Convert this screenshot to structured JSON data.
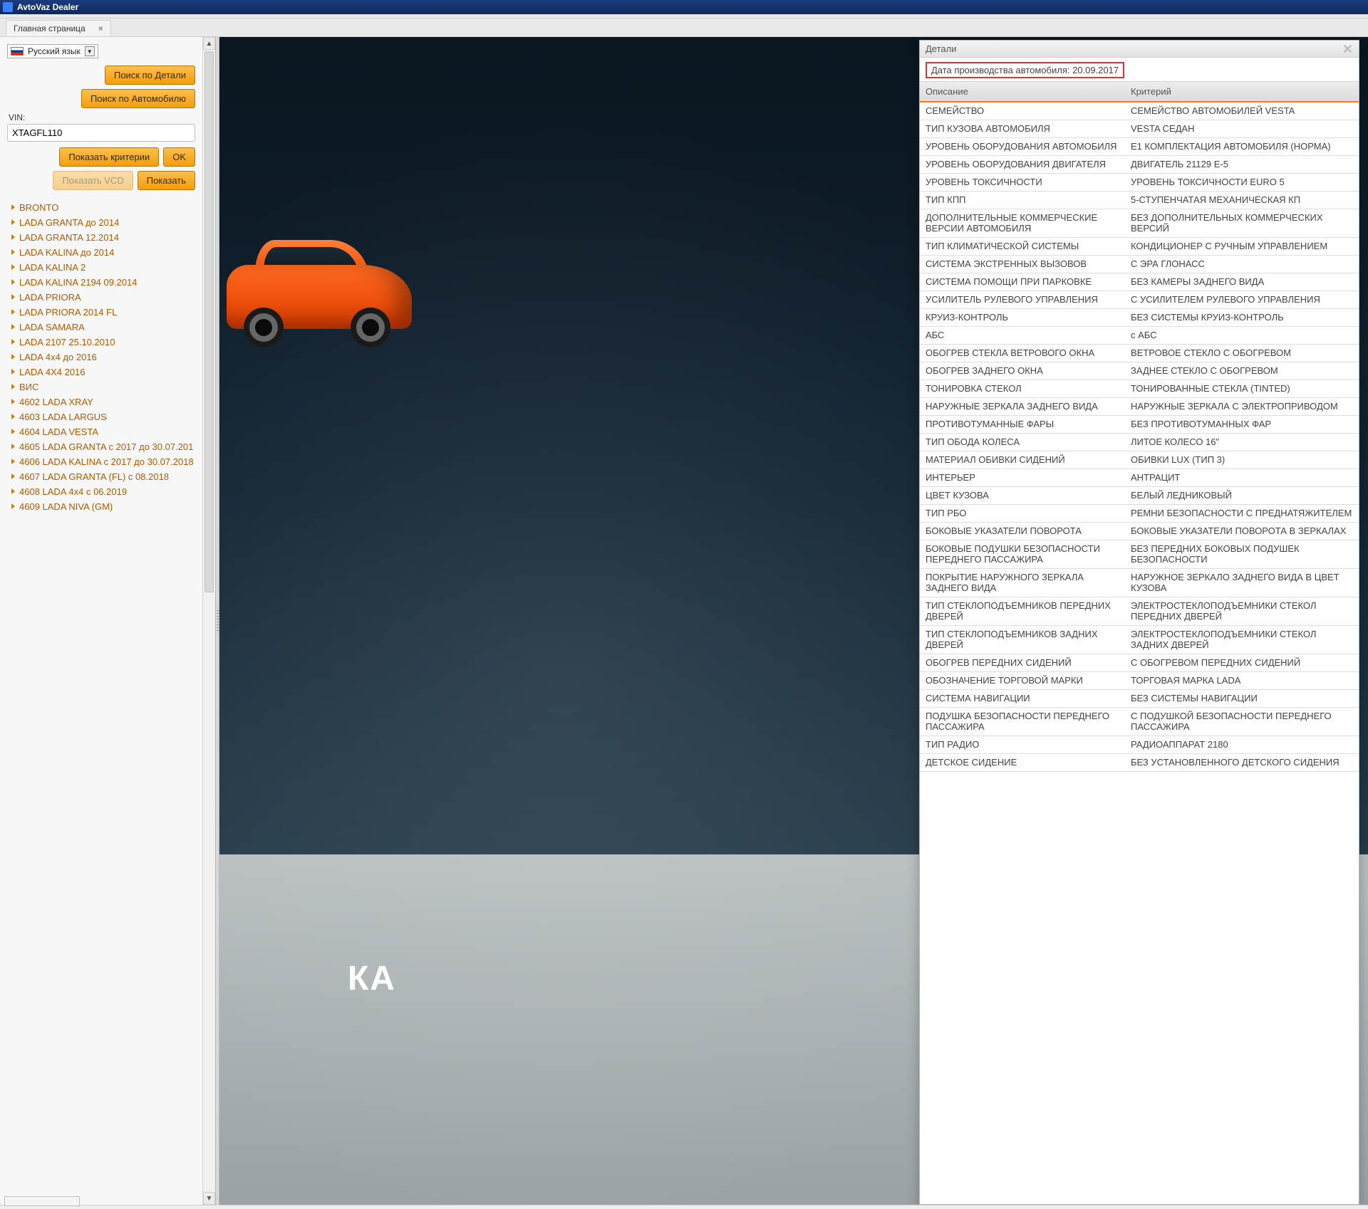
{
  "window": {
    "title": "AvtoVaz Dealer"
  },
  "tabs": [
    {
      "label": "Главная страница"
    }
  ],
  "sidebar": {
    "language": "Русский язык",
    "buttons": {
      "search_parts": "Поиск по Детали",
      "search_vehicle": "Поиск по Автомобилю",
      "show_criteria": "Показать критерии",
      "ok": "OK",
      "show_vcd": "Показать VCD",
      "show": "Показать"
    },
    "vin_label": "VIN:",
    "vin_value": "XTAGFL110",
    "tree": [
      "BRONTO",
      "LADA GRANTA до 2014",
      "LADA GRANTA 12.2014",
      "LADA KALINA до 2014",
      "LADA KALINA 2",
      "LADA KALINA 2194 09.2014",
      "LADA PRIORA",
      "LADA PRIORA 2014 FL",
      "LADA SAMARA",
      "LADA 2107 25.10.2010",
      "LADA 4x4 до 2016",
      "LADA 4X4 2016",
      "ВИС",
      "4602 LADA XRAY",
      "4603 LADA LARGUS",
      "4604 LADA VESTA",
      "4605 LADA GRANTA с 2017 до 30.07.201",
      "4606 LADA KALINA с 2017 до 30.07.2018",
      "4607 LADA GRANTA (FL) с 08.2018",
      "4608 LADA 4x4 с 06.2019",
      "4609 LADA NIVA (GM)"
    ]
  },
  "hero": {
    "text": "КА"
  },
  "modal": {
    "title": "Детали",
    "date": "Дата производства автомобиля: 20.09.2017",
    "col_desc": "Описание",
    "col_crit": "Критерий",
    "rows": [
      [
        "СЕМЕЙСТВО",
        "СЕМЕЙСТВО АВТОМОБИЛЕЙ VESTA"
      ],
      [
        "ТИП КУЗОВА АВТОМОБИЛЯ",
        "VESTA СЕДАН"
      ],
      [
        "УРОВЕНЬ ОБОРУДОВАНИЯ АВТОМОБИЛЯ",
        "Е1 КОМПЛЕКТАЦИЯ АВТОМОБИЛЯ (НОРМА)"
      ],
      [
        "УРОВЕНЬ ОБОРУДОВАНИЯ ДВИГАТЕЛЯ",
        "ДВИГАТЕЛЬ 21129 Е-5"
      ],
      [
        "УРОВЕНЬ ТОКСИЧНОСТИ",
        "УРОВЕНЬ ТОКСИЧНОСТИ EURO 5"
      ],
      [
        "ТИП КПП",
        "5-СТУПЕНЧАТАЯ МЕХАНИЧЕСКАЯ КП"
      ],
      [
        "ДОПОЛНИТЕЛЬНЫЕ КОММЕРЧЕСКИЕ ВЕРСИИ АВТОМОБИЛЯ",
        "БЕЗ ДОПОЛНИТЕЛЬНЫХ КОММЕРЧЕСКИХ ВЕРСИЙ"
      ],
      [
        "ТИП КЛИМАТИЧЕСКОЙ СИСТЕМЫ",
        "КОНДИЦИОНЕР С РУЧНЫМ УПРАВЛЕНИЕМ"
      ],
      [
        "СИСТЕМА ЭКСТРЕННЫХ ВЫЗОВОВ",
        "С ЭРА ГЛОНАСС"
      ],
      [
        "СИСТЕМА ПОМОЩИ ПРИ ПАРКОВКЕ",
        "БЕЗ КАМЕРЫ ЗАДНЕГО ВИДА"
      ],
      [
        "УСИЛИТЕЛЬ РУЛЕВОГО УПРАВЛЕНИЯ",
        "С УСИЛИТЕЛЕМ РУЛЕВОГО УПРАВЛЕНИЯ"
      ],
      [
        "КРУИЗ-КОНТРОЛЬ",
        "БЕЗ СИСТЕМЫ КРУИЗ-КОНТРОЛЬ"
      ],
      [
        "АБС",
        "с АБС"
      ],
      [
        "ОБОГРЕВ СТЕКЛА ВЕТРОВОГО ОКНА",
        "ВЕТРОВОЕ СТЕКЛО С ОБОГРЕВОМ"
      ],
      [
        "ОБОГРЕВ ЗАДНЕГО ОКНА",
        "ЗАДНЕЕ СТЕКЛО С ОБОГРЕВОМ"
      ],
      [
        "ТОНИРОВКА СТЕКОЛ",
        "ТОНИРОВАННЫЕ СТЕКЛА (TINTED)"
      ],
      [
        "НАРУЖНЫЕ ЗЕРКАЛА ЗАДНЕГО ВИДА",
        "НАРУЖНЫЕ ЗЕРКАЛА С ЭЛЕКТРОПРИВОДОМ"
      ],
      [
        "ПРОТИВОТУМАННЫЕ ФАРЫ",
        "БЕЗ ПРОТИВОТУМАННЫХ ФАР"
      ],
      [
        "ТИП ОБОДА КОЛЕСА",
        "ЛИТОЕ КОЛЕСО 16\""
      ],
      [
        "МАТЕРИАЛ ОБИВКИ СИДЕНИЙ",
        "ОБИВКИ LUX (ТИП 3)"
      ],
      [
        "ИНТЕРЬЕР",
        "АНТРАЦИТ"
      ],
      [
        "ЦВЕТ КУЗОВА",
        "БЕЛЫЙ ЛЕДНИКОВЫЙ"
      ],
      [
        "ТИП РБО",
        "РЕМНИ БЕЗОПАСНОСТИ С ПРЕДНАТЯЖИТЕЛЕМ"
      ],
      [
        "БОКОВЫЕ УКАЗАТЕЛИ ПОВОРОТА",
        "БОКОВЫЕ УКАЗАТЕЛИ ПОВОРОТА В ЗЕРКАЛАХ"
      ],
      [
        "БОКОВЫЕ ПОДУШКИ БЕЗОПАСНОСТИ ПЕРЕДНЕГО ПАССАЖИРА",
        "БЕЗ ПЕРЕДНИХ БОКОВЫХ ПОДУШЕК БЕЗОПАСНОСТИ"
      ],
      [
        "ПОКРЫТИЕ НАРУЖНОГО ЗЕРКАЛА ЗАДНЕГО ВИДА",
        "НАРУЖНОЕ ЗЕРКАЛО ЗАДНЕГО ВИДА В ЦВЕТ КУЗОВА"
      ],
      [
        "ТИП СТЕКЛОПОДЪЕМНИКОВ ПЕРЕДНИХ ДВЕРЕЙ",
        "ЭЛЕКТРОСТЕКЛОПОДЪЕМНИКИ СТЕКОЛ ПЕРЕДНИХ ДВЕРЕЙ"
      ],
      [
        "ТИП СТЕКЛОПОДЪЕМНИКОВ ЗАДНИХ ДВЕРЕЙ",
        "ЭЛЕКТРОСТЕКЛОПОДЪЕМНИКИ СТЕКОЛ ЗАДНИХ ДВЕРЕЙ"
      ],
      [
        "ОБОГРЕВ ПЕРЕДНИХ СИДЕНИЙ",
        "С ОБОГРЕВОМ ПЕРЕДНИХ СИДЕНИЙ"
      ],
      [
        "ОБОЗНАЧЕНИЕ ТОРГОВОЙ МАРКИ",
        "ТОРГОВАЯ МАРКА LADA"
      ],
      [
        "СИСТЕМА НАВИГАЦИИ",
        "БЕЗ СИСТЕМЫ НАВИГАЦИИ"
      ],
      [
        "ПОДУШКА БЕЗОПАСНОСТИ ПЕРЕДНЕГО ПАССАЖИРА",
        "С ПОДУШКОЙ БЕЗОПАСНОСТИ ПЕРЕДНЕГО ПАССАЖИРА"
      ],
      [
        "ТИП РАДИО",
        "РАДИОАППАРАТ 2180"
      ],
      [
        "ДЕТСКОЕ СИДЕНИЕ",
        "БЕЗ УСТАНОВЛЕННОГО ДЕТСКОГО СИДЕНИЯ"
      ]
    ]
  }
}
